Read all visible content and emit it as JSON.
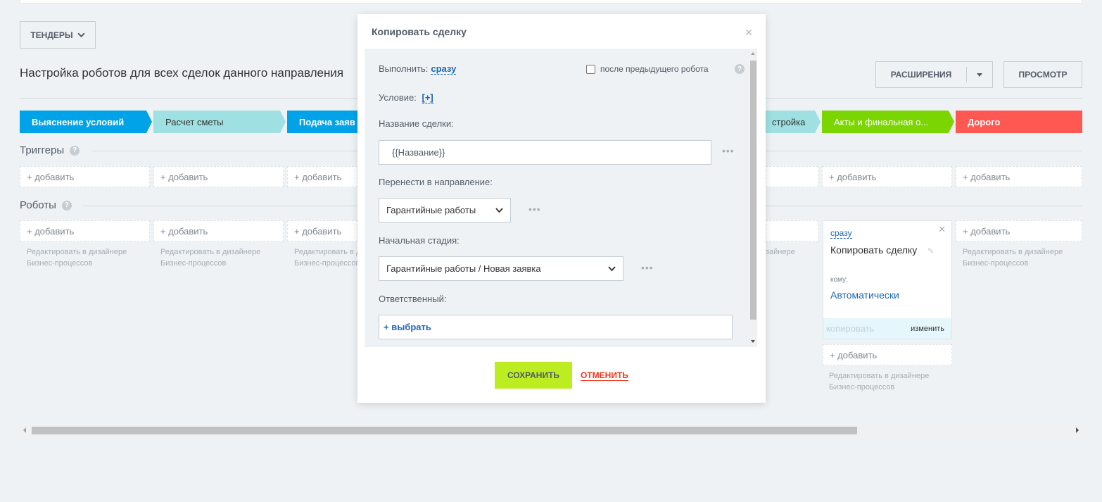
{
  "header": {
    "tenders_button": "ТЕНДЕРЫ",
    "page_title": "Настройка роботов для всех сделок данного направления",
    "extensions_button": "РАСШИРЕНИЯ",
    "preview_button": "ПРОСМОТР"
  },
  "stages": [
    {
      "label": "Выяснение условий",
      "color": "#00a2e8"
    },
    {
      "label": "Расчет сметы",
      "color": "#9fe0e2"
    },
    {
      "label": "Подача заяв",
      "color": "#00a2e8"
    },
    {
      "label": "стройка",
      "color": "#9fe0e2"
    },
    {
      "label": "Акты и финальная о...",
      "color": "#7bd500"
    },
    {
      "label": "Дорого",
      "color": "#ff5752"
    }
  ],
  "triggers": {
    "title": "Триггеры",
    "add_label": "+ добавить"
  },
  "robots": {
    "title": "Роботы",
    "add_label": "+ добавить",
    "edit_hint_line1": "Редактировать в дизайнере",
    "edit_hint_line2": "Бизнес-процессов",
    "edit_hint_cut_line1": "Редактировать в д",
    "edit_hint_cut_line2": "Бизнес-процессов",
    "edit_hint_tail": "зайнере",
    "card": {
      "when": "сразу",
      "name": "Копировать сделку",
      "whom_label": "кому:",
      "whom_value": "Автоматически",
      "copy_label": "копировать",
      "change_label": "изменить"
    }
  },
  "modal": {
    "title": "Копировать сделку",
    "execute_label": "Выполнить:",
    "execute_value": "сразу",
    "after_previous_label": "после предыдущего робота",
    "condition_label": "Условие:",
    "condition_link": "[+]",
    "deal_name_label": "Название сделки:",
    "deal_name_value": "{{Название}}",
    "move_to_label": "Перенести в направление:",
    "move_to_value": "Гарантийные работы",
    "initial_stage_label": "Начальная стадия:",
    "initial_stage_value": "Гарантийные работы / Новая заявка",
    "responsible_label": "Ответственный:",
    "select_label": "+ выбрать",
    "save_button": "СОХРАНИТЬ",
    "cancel_button": "ОТМЕНИТЬ"
  },
  "icons": {
    "chevron": "chevron-down-icon",
    "help": "help-icon",
    "close": "close-icon",
    "more": "more-dots-icon",
    "pencil": "pencil-icon"
  }
}
